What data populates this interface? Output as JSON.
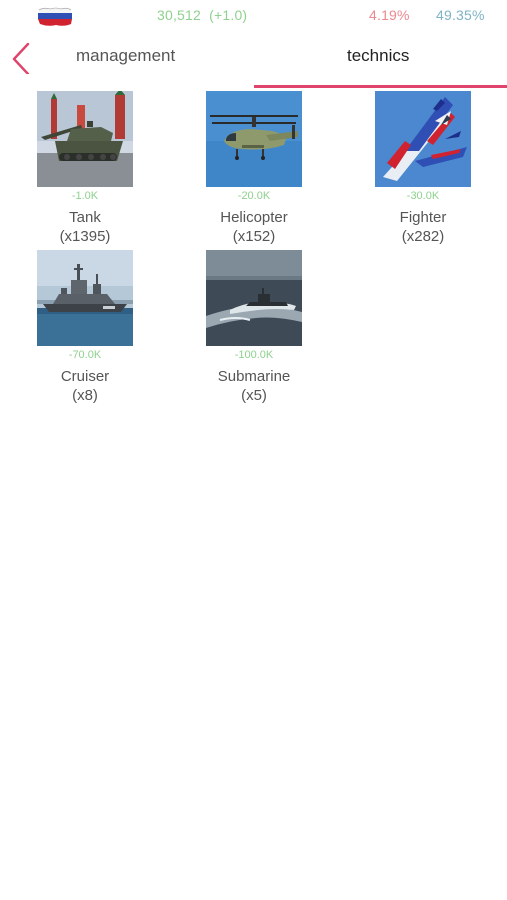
{
  "header": {
    "money": "30,512",
    "money_delta": "(+1.0)",
    "percent_a": "4.19%",
    "percent_b": "49.35%",
    "flag_icon": "russia-flag-icon"
  },
  "tabs": {
    "management": "management",
    "technics": "technics",
    "active": "technics"
  },
  "items": [
    {
      "name": "Tank",
      "cost": "-1.0K",
      "count": "(x1395)",
      "icon": "tank-image"
    },
    {
      "name": "Helicopter",
      "cost": "-20.0K",
      "count": "(x152)",
      "icon": "helicopter-image"
    },
    {
      "name": "Fighter",
      "cost": "-30.0K",
      "count": "(x282)",
      "icon": "fighter-jet-image"
    },
    {
      "name": "Cruiser",
      "cost": "-70.0K",
      "count": "(x8)",
      "icon": "cruiser-ship-image"
    },
    {
      "name": "Submarine",
      "cost": "-100.0K",
      "count": "(x5)",
      "icon": "submarine-image"
    }
  ],
  "colors": {
    "accent": "#e0436c",
    "money_green": "#8fd18e",
    "stat_red": "#ea8a8f",
    "stat_blue": "#7fb3c6"
  }
}
